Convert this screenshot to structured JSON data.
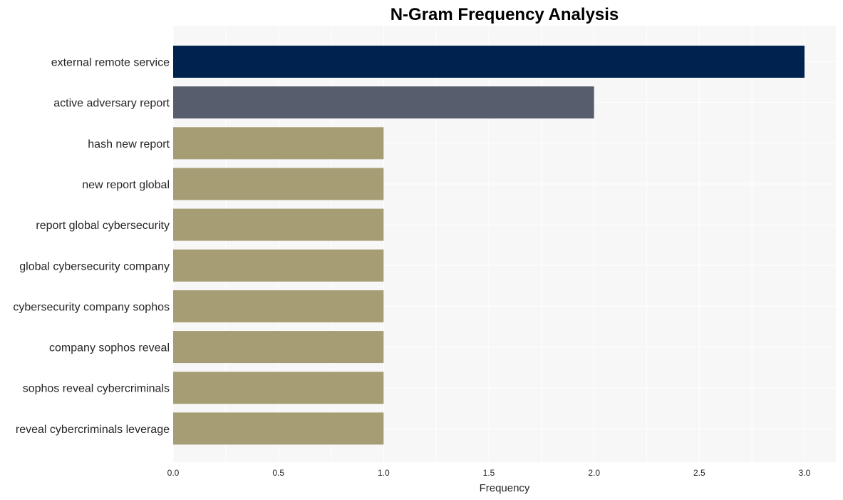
{
  "chart_data": {
    "type": "bar",
    "orientation": "horizontal",
    "title": "N-Gram Frequency Analysis",
    "xlabel": "Frequency",
    "ylabel": "",
    "xlim": [
      0,
      3.15
    ],
    "xticks": [
      0.0,
      0.5,
      1.0,
      1.5,
      2.0,
      2.5,
      3.0
    ],
    "xtick_labels": [
      "0.0",
      "0.5",
      "1.0",
      "1.5",
      "2.0",
      "2.5",
      "3.0"
    ],
    "grid": true,
    "legend": "none",
    "categories": [
      "external remote service",
      "active adversary report",
      "hash new report",
      "new report global",
      "report global cybersecurity",
      "global cybersecurity company",
      "cybersecurity company sophos",
      "company sophos reveal",
      "sophos reveal cybercriminals",
      "reveal cybercriminals leverage"
    ],
    "values": [
      3,
      2,
      1,
      1,
      1,
      1,
      1,
      1,
      1,
      1
    ],
    "colors": [
      "#00224e",
      "#575d6d",
      "#a69d75",
      "#a69d75",
      "#a69d75",
      "#a69d75",
      "#a69d75",
      "#a69d75",
      "#a69d75",
      "#a69d75"
    ],
    "background_color": "#f7f7f7",
    "grid_color": "#ffffff"
  }
}
